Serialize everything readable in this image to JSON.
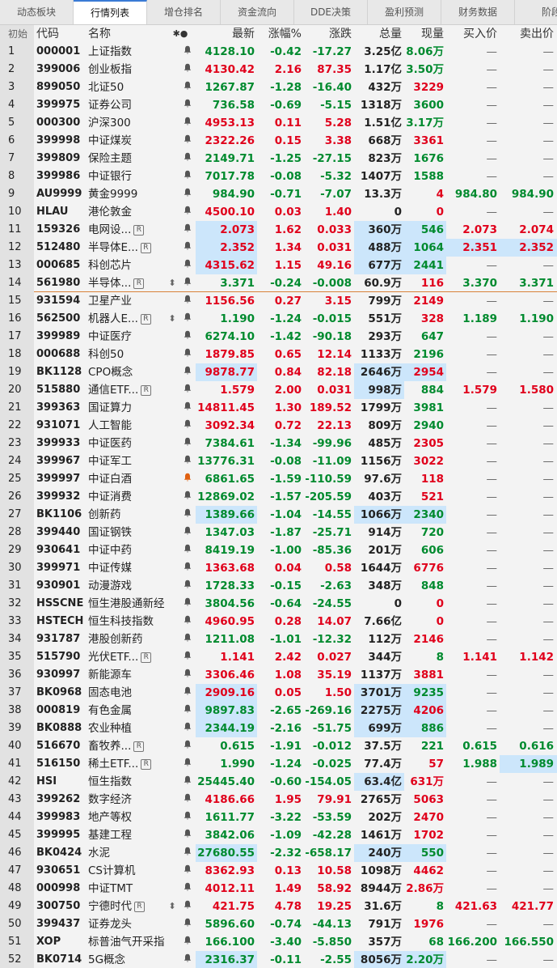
{
  "tabs": [
    "动态板块",
    "行情列表",
    "增仓排名",
    "资金流向",
    "DDE决策",
    "盈利预测",
    "财务数据",
    "阶段"
  ],
  "active_tab": 1,
  "header": {
    "idx": "初始",
    "code": "代码",
    "name": "名称",
    "mark": "✱●",
    "last": "最新",
    "pct": "涨幅%",
    "chg": "涨跌",
    "vol": "总量",
    "cur": "现量",
    "bid": "买入价",
    "ask": "卖出价"
  },
  "rows": [
    {
      "i": "1",
      "code": "000001",
      "name": "上证指数",
      "last": "4128.10",
      "pct": "-0.42",
      "chg": "-17.27",
      "vol": "3.25亿",
      "cur": "8.06万",
      "bid": "—",
      "ask": "—",
      "d": "dn",
      "cd": "dn"
    },
    {
      "i": "2",
      "code": "399006",
      "name": "创业板指",
      "last": "4130.42",
      "pct": "2.16",
      "chg": "87.35",
      "vol": "1.17亿",
      "cur": "3.50万",
      "bid": "—",
      "ask": "—",
      "d": "up",
      "cd": "dn"
    },
    {
      "i": "3",
      "code": "899050",
      "name": "北证50",
      "last": "1267.87",
      "pct": "-1.28",
      "chg": "-16.40",
      "vol": "432万",
      "cur": "3229",
      "bid": "—",
      "ask": "—",
      "d": "dn",
      "cd": "up"
    },
    {
      "i": "4",
      "code": "399975",
      "name": "证券公司",
      "last": "736.58",
      "pct": "-0.69",
      "chg": "-5.15",
      "vol": "1318万",
      "cur": "3600",
      "bid": "—",
      "ask": "—",
      "d": "dn",
      "cd": "dn"
    },
    {
      "i": "5",
      "code": "000300",
      "name": "沪深300",
      "last": "4953.13",
      "pct": "0.11",
      "chg": "5.28",
      "vol": "1.51亿",
      "cur": "3.17万",
      "bid": "—",
      "ask": "—",
      "d": "up",
      "cd": "dn"
    },
    {
      "i": "6",
      "code": "399998",
      "name": "中证煤炭",
      "last": "2322.26",
      "pct": "0.15",
      "chg": "3.38",
      "vol": "668万",
      "cur": "3361",
      "bid": "—",
      "ask": "—",
      "d": "up",
      "cd": "up"
    },
    {
      "i": "7",
      "code": "399809",
      "name": "保险主题",
      "last": "2149.71",
      "pct": "-1.25",
      "chg": "-27.15",
      "vol": "823万",
      "cur": "1676",
      "bid": "—",
      "ask": "—",
      "d": "dn",
      "cd": "dn"
    },
    {
      "i": "8",
      "code": "399986",
      "name": "中证银行",
      "last": "7017.78",
      "pct": "-0.08",
      "chg": "-5.32",
      "vol": "1407万",
      "cur": "1588",
      "bid": "—",
      "ask": "—",
      "d": "dn",
      "cd": "dn"
    },
    {
      "i": "9",
      "code": "AU9999",
      "name": "黄金9999",
      "last": "984.90",
      "pct": "-0.71",
      "chg": "-7.07",
      "vol": "13.3万",
      "cur": "4",
      "bid": "984.80",
      "ask": "984.90",
      "d": "dn",
      "cd": "up"
    },
    {
      "i": "10",
      "code": "HLAU",
      "name": "港伦敦金",
      "last": "4500.10",
      "pct": "0.03",
      "chg": "1.40",
      "vol": "0",
      "cur": "0",
      "bid": "—",
      "ask": "—",
      "d": "up",
      "cd": "up"
    },
    {
      "i": "11",
      "code": "159326",
      "name": "电网设...",
      "r": true,
      "last": "2.073",
      "pct": "1.62",
      "chg": "0.033",
      "vol": "360万",
      "cur": "546",
      "bid": "2.073",
      "ask": "2.074",
      "d": "up",
      "cd": "dn",
      "hl": [
        "last",
        "vol",
        "cur"
      ]
    },
    {
      "i": "12",
      "code": "512480",
      "name": "半导体E...",
      "r": true,
      "last": "2.352",
      "pct": "1.34",
      "chg": "0.031",
      "vol": "488万",
      "cur": "1064",
      "bid": "2.351",
      "ask": "2.352",
      "d": "up",
      "cd": "dn",
      "hl": [
        "last",
        "vol",
        "cur",
        "bid",
        "ask"
      ]
    },
    {
      "i": "13",
      "code": "000685",
      "name": "科创芯片",
      "last": "4315.62",
      "pct": "1.15",
      "chg": "49.16",
      "vol": "677万",
      "cur": "2441",
      "bid": "—",
      "ask": "—",
      "d": "up",
      "cd": "dn",
      "hl": [
        "last",
        "vol",
        "cur"
      ]
    },
    {
      "i": "14",
      "code": "561980",
      "name": "半导体...",
      "r": true,
      "mk": "⇕",
      "last": "3.371",
      "pct": "-0.24",
      "chg": "-0.008",
      "vol": "60.9万",
      "cur": "116",
      "bid": "3.370",
      "ask": "3.371",
      "d": "dn",
      "cd": "up",
      "sep": true
    },
    {
      "i": "15",
      "code": "931594",
      "name": "卫星产业",
      "last": "1156.56",
      "pct": "0.27",
      "chg": "3.15",
      "vol": "799万",
      "cur": "2149",
      "bid": "—",
      "ask": "—",
      "d": "up",
      "cd": "up"
    },
    {
      "i": "16",
      "code": "562500",
      "name": "机器人E...",
      "r": true,
      "mk": "⇕",
      "last": "1.190",
      "pct": "-1.24",
      "chg": "-0.015",
      "vol": "551万",
      "cur": "328",
      "bid": "1.189",
      "ask": "1.190",
      "d": "dn",
      "cd": "up"
    },
    {
      "i": "17",
      "code": "399989",
      "name": "中证医疗",
      "last": "6274.10",
      "pct": "-1.42",
      "chg": "-90.18",
      "vol": "293万",
      "cur": "647",
      "bid": "—",
      "ask": "—",
      "d": "dn",
      "cd": "dn"
    },
    {
      "i": "18",
      "code": "000688",
      "name": "科创50",
      "last": "1879.85",
      "pct": "0.65",
      "chg": "12.14",
      "vol": "1133万",
      "cur": "2196",
      "bid": "—",
      "ask": "—",
      "d": "up",
      "cd": "dn"
    },
    {
      "i": "19",
      "code": "BK1128",
      "name": "CPO概念",
      "last": "9878.77",
      "pct": "0.84",
      "chg": "82.18",
      "vol": "2646万",
      "cur": "2954",
      "bid": "—",
      "ask": "—",
      "d": "up",
      "cd": "up",
      "hl": [
        "last",
        "vol",
        "cur"
      ]
    },
    {
      "i": "20",
      "code": "515880",
      "name": "通信ETF...",
      "r": true,
      "last": "1.579",
      "pct": "2.00",
      "chg": "0.031",
      "vol": "998万",
      "cur": "884",
      "bid": "1.579",
      "ask": "1.580",
      "d": "up",
      "cd": "dn",
      "hl": [
        "vol"
      ]
    },
    {
      "i": "21",
      "code": "399363",
      "name": "国证算力",
      "last": "14811.45",
      "pct": "1.30",
      "chg": "189.52",
      "vol": "1799万",
      "cur": "3981",
      "bid": "—",
      "ask": "—",
      "d": "up",
      "cd": "dn"
    },
    {
      "i": "22",
      "code": "931071",
      "name": "人工智能",
      "last": "3092.34",
      "pct": "0.72",
      "chg": "22.13",
      "vol": "809万",
      "cur": "2940",
      "bid": "—",
      "ask": "—",
      "d": "up",
      "cd": "dn"
    },
    {
      "i": "23",
      "code": "399933",
      "name": "中证医药",
      "last": "7384.61",
      "pct": "-1.34",
      "chg": "-99.96",
      "vol": "485万",
      "cur": "2305",
      "bid": "—",
      "ask": "—",
      "d": "dn",
      "cd": "up"
    },
    {
      "i": "24",
      "code": "399967",
      "name": "中证军工",
      "last": "13776.31",
      "pct": "-0.08",
      "chg": "-11.09",
      "vol": "1156万",
      "cur": "3022",
      "bid": "—",
      "ask": "—",
      "d": "dn",
      "cd": "up"
    },
    {
      "i": "25",
      "code": "399997",
      "name": "中证白酒",
      "alarm": true,
      "last": "6861.65",
      "pct": "-1.59",
      "chg": "-110.59",
      "vol": "97.6万",
      "cur": "118",
      "bid": "—",
      "ask": "—",
      "d": "dn",
      "cd": "up"
    },
    {
      "i": "26",
      "code": "399932",
      "name": "中证消费",
      "last": "12869.02",
      "pct": "-1.57",
      "chg": "-205.59",
      "vol": "403万",
      "cur": "521",
      "bid": "—",
      "ask": "—",
      "d": "dn",
      "cd": "up"
    },
    {
      "i": "27",
      "code": "BK1106",
      "name": "创新药",
      "last": "1389.66",
      "pct": "-1.04",
      "chg": "-14.55",
      "vol": "1066万",
      "cur": "2340",
      "bid": "—",
      "ask": "—",
      "d": "dn",
      "cd": "dn",
      "hl": [
        "last",
        "vol",
        "cur"
      ]
    },
    {
      "i": "28",
      "code": "399440",
      "name": "国证钢铁",
      "last": "1347.03",
      "pct": "-1.87",
      "chg": "-25.71",
      "vol": "914万",
      "cur": "720",
      "bid": "—",
      "ask": "—",
      "d": "dn",
      "cd": "dn"
    },
    {
      "i": "29",
      "code": "930641",
      "name": "中证中药",
      "last": "8419.19",
      "pct": "-1.00",
      "chg": "-85.36",
      "vol": "201万",
      "cur": "606",
      "bid": "—",
      "ask": "—",
      "d": "dn",
      "cd": "dn"
    },
    {
      "i": "30",
      "code": "399971",
      "name": "中证传媒",
      "last": "1363.68",
      "pct": "0.04",
      "chg": "0.58",
      "vol": "1644万",
      "cur": "6776",
      "bid": "—",
      "ask": "—",
      "d": "up",
      "cd": "up"
    },
    {
      "i": "31",
      "code": "930901",
      "name": "动漫游戏",
      "last": "1728.33",
      "pct": "-0.15",
      "chg": "-2.63",
      "vol": "348万",
      "cur": "848",
      "bid": "—",
      "ask": "—",
      "d": "dn",
      "cd": "dn"
    },
    {
      "i": "32",
      "code": "HSSCNE",
      "name": "恒生港股通新经...",
      "last": "3804.56",
      "pct": "-0.64",
      "chg": "-24.55",
      "vol": "0",
      "cur": "0",
      "bid": "—",
      "ask": "—",
      "d": "dn",
      "cd": "up"
    },
    {
      "i": "33",
      "code": "HSTECH",
      "name": "恒生科技指数",
      "last": "4960.95",
      "pct": "0.28",
      "chg": "14.07",
      "vol": "7.66亿",
      "cur": "0",
      "bid": "—",
      "ask": "—",
      "d": "up",
      "cd": "up"
    },
    {
      "i": "34",
      "code": "931787",
      "name": "港股创新药",
      "last": "1211.08",
      "pct": "-1.01",
      "chg": "-12.32",
      "vol": "112万",
      "cur": "2146",
      "bid": "—",
      "ask": "—",
      "d": "dn",
      "cd": "up"
    },
    {
      "i": "35",
      "code": "515790",
      "name": "光伏ETF...",
      "r": true,
      "last": "1.141",
      "pct": "2.42",
      "chg": "0.027",
      "vol": "344万",
      "cur": "8",
      "bid": "1.141",
      "ask": "1.142",
      "d": "up",
      "cd": "dn"
    },
    {
      "i": "36",
      "code": "930997",
      "name": "新能源车",
      "last": "3306.46",
      "pct": "1.08",
      "chg": "35.19",
      "vol": "1137万",
      "cur": "3881",
      "bid": "—",
      "ask": "—",
      "d": "up",
      "cd": "up"
    },
    {
      "i": "37",
      "code": "BK0968",
      "name": "固态电池",
      "last": "2909.16",
      "pct": "0.05",
      "chg": "1.50",
      "vol": "3701万",
      "cur": "9235",
      "bid": "—",
      "ask": "—",
      "d": "up",
      "cd": "dn",
      "hl": [
        "last",
        "vol",
        "cur"
      ]
    },
    {
      "i": "38",
      "code": "000819",
      "name": "有色金属",
      "last": "9897.83",
      "pct": "-2.65",
      "chg": "-269.16",
      "vol": "2275万",
      "cur": "4206",
      "bid": "—",
      "ask": "—",
      "d": "dn",
      "cd": "up",
      "hl": [
        "last",
        "vol",
        "cur"
      ]
    },
    {
      "i": "39",
      "code": "BK0888",
      "name": "农业种植",
      "last": "2344.19",
      "pct": "-2.16",
      "chg": "-51.75",
      "vol": "699万",
      "cur": "886",
      "bid": "—",
      "ask": "—",
      "d": "dn",
      "cd": "dn",
      "hl": [
        "last",
        "vol",
        "cur"
      ]
    },
    {
      "i": "40",
      "code": "516670",
      "name": "畜牧养...",
      "r": true,
      "last": "0.615",
      "pct": "-1.91",
      "chg": "-0.012",
      "vol": "37.5万",
      "cur": "221",
      "bid": "0.615",
      "ask": "0.616",
      "d": "dn",
      "cd": "dn"
    },
    {
      "i": "41",
      "code": "516150",
      "name": "稀土ETF...",
      "r": true,
      "last": "1.990",
      "pct": "-1.24",
      "chg": "-0.025",
      "vol": "77.4万",
      "cur": "57",
      "bid": "1.988",
      "ask": "1.989",
      "d": "dn",
      "cd": "up",
      "hl": [
        "ask"
      ]
    },
    {
      "i": "42",
      "code": "HSI",
      "name": "恒生指数",
      "last": "25445.40",
      "pct": "-0.60",
      "chg": "-154.05",
      "vol": "63.4亿",
      "cur": "631万",
      "bid": "—",
      "ask": "—",
      "d": "dn",
      "cd": "up",
      "hl": [
        "vol"
      ]
    },
    {
      "i": "43",
      "code": "399262",
      "name": "数字经济",
      "last": "4186.66",
      "pct": "1.95",
      "chg": "79.91",
      "vol": "2765万",
      "cur": "5063",
      "bid": "—",
      "ask": "—",
      "d": "up",
      "cd": "up"
    },
    {
      "i": "44",
      "code": "399983",
      "name": "地产等权",
      "last": "1611.77",
      "pct": "-3.22",
      "chg": "-53.59",
      "vol": "202万",
      "cur": "2470",
      "bid": "—",
      "ask": "—",
      "d": "dn",
      "cd": "up"
    },
    {
      "i": "45",
      "code": "399995",
      "name": "基建工程",
      "last": "3842.06",
      "pct": "-1.09",
      "chg": "-42.28",
      "vol": "1461万",
      "cur": "1702",
      "bid": "—",
      "ask": "—",
      "d": "dn",
      "cd": "up"
    },
    {
      "i": "46",
      "code": "BK0424",
      "name": "水泥",
      "last": "27680.55",
      "pct": "-2.32",
      "chg": "-658.17",
      "vol": "240万",
      "cur": "550",
      "bid": "—",
      "ask": "—",
      "d": "dn",
      "cd": "dn",
      "hl": [
        "last",
        "vol",
        "cur"
      ]
    },
    {
      "i": "47",
      "code": "930651",
      "name": "CS计算机",
      "last": "8362.93",
      "pct": "0.13",
      "chg": "10.58",
      "vol": "1098万",
      "cur": "4462",
      "bid": "—",
      "ask": "—",
      "d": "up",
      "cd": "up"
    },
    {
      "i": "48",
      "code": "000998",
      "name": "中证TMT",
      "last": "4012.11",
      "pct": "1.49",
      "chg": "58.92",
      "vol": "8944万",
      "cur": "2.86万",
      "bid": "—",
      "ask": "—",
      "d": "up",
      "cd": "up"
    },
    {
      "i": "49",
      "code": "300750",
      "name": "宁德时代",
      "r": true,
      "mk": "⇕",
      "last": "421.75",
      "pct": "4.78",
      "chg": "19.25",
      "vol": "31.6万",
      "cur": "8",
      "bid": "421.63",
      "ask": "421.77",
      "d": "up",
      "cd": "dn"
    },
    {
      "i": "50",
      "code": "399437",
      "name": "证券龙头",
      "last": "5896.60",
      "pct": "-0.74",
      "chg": "-44.13",
      "vol": "791万",
      "cur": "1976",
      "bid": "—",
      "ask": "—",
      "d": "dn",
      "cd": "up"
    },
    {
      "i": "51",
      "code": "XOP",
      "name": "标普油气开采指...",
      "last": "166.100",
      "pct": "-3.40",
      "chg": "-5.850",
      "vol": "357万",
      "cur": "68",
      "bid": "166.200",
      "ask": "166.550",
      "d": "dn",
      "cd": "dn"
    },
    {
      "i": "52",
      "code": "BK0714",
      "name": "5G概念",
      "last": "2316.37",
      "pct": "-0.11",
      "chg": "-2.55",
      "vol": "8056万",
      "cur": "2.20万",
      "bid": "—",
      "ask": "—",
      "d": "dn",
      "cd": "dn",
      "hl": [
        "last",
        "vol",
        "cur"
      ]
    }
  ]
}
